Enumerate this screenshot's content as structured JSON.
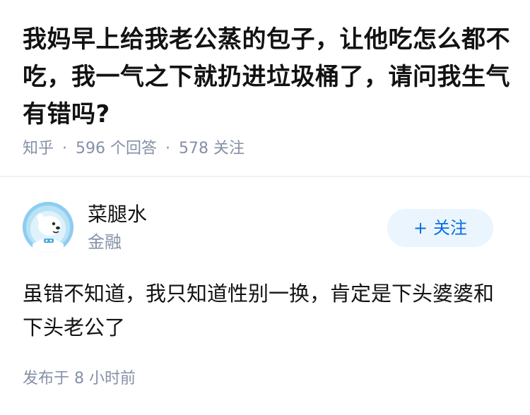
{
  "question": {
    "title": "我妈早上给我老公蒸的包子，让他吃怎么都不吃，我一气之下就扔进垃圾桶了，请问我生气有错吗?",
    "platform": "知乎",
    "answers_count": "596 个回答",
    "followers_count": "578 关注",
    "separator": "·"
  },
  "answer": {
    "author": {
      "name": "菜腿水",
      "subtitle": "金融",
      "avatar_icon": "dog-astronaut-avatar-icon"
    },
    "follow_button": {
      "icon": "+",
      "label": "关注"
    },
    "content": "虽错不知道，我只知道性别一换，肯定是下头婆婆和下头老公了",
    "meta": "发布于  8 小时前"
  },
  "colors": {
    "text_primary": "#121212",
    "text_secondary": "#8590a6",
    "accent": "#056de8",
    "follow_bg": "#ebf5fd",
    "avatar_bg": "#8ecdf0"
  }
}
